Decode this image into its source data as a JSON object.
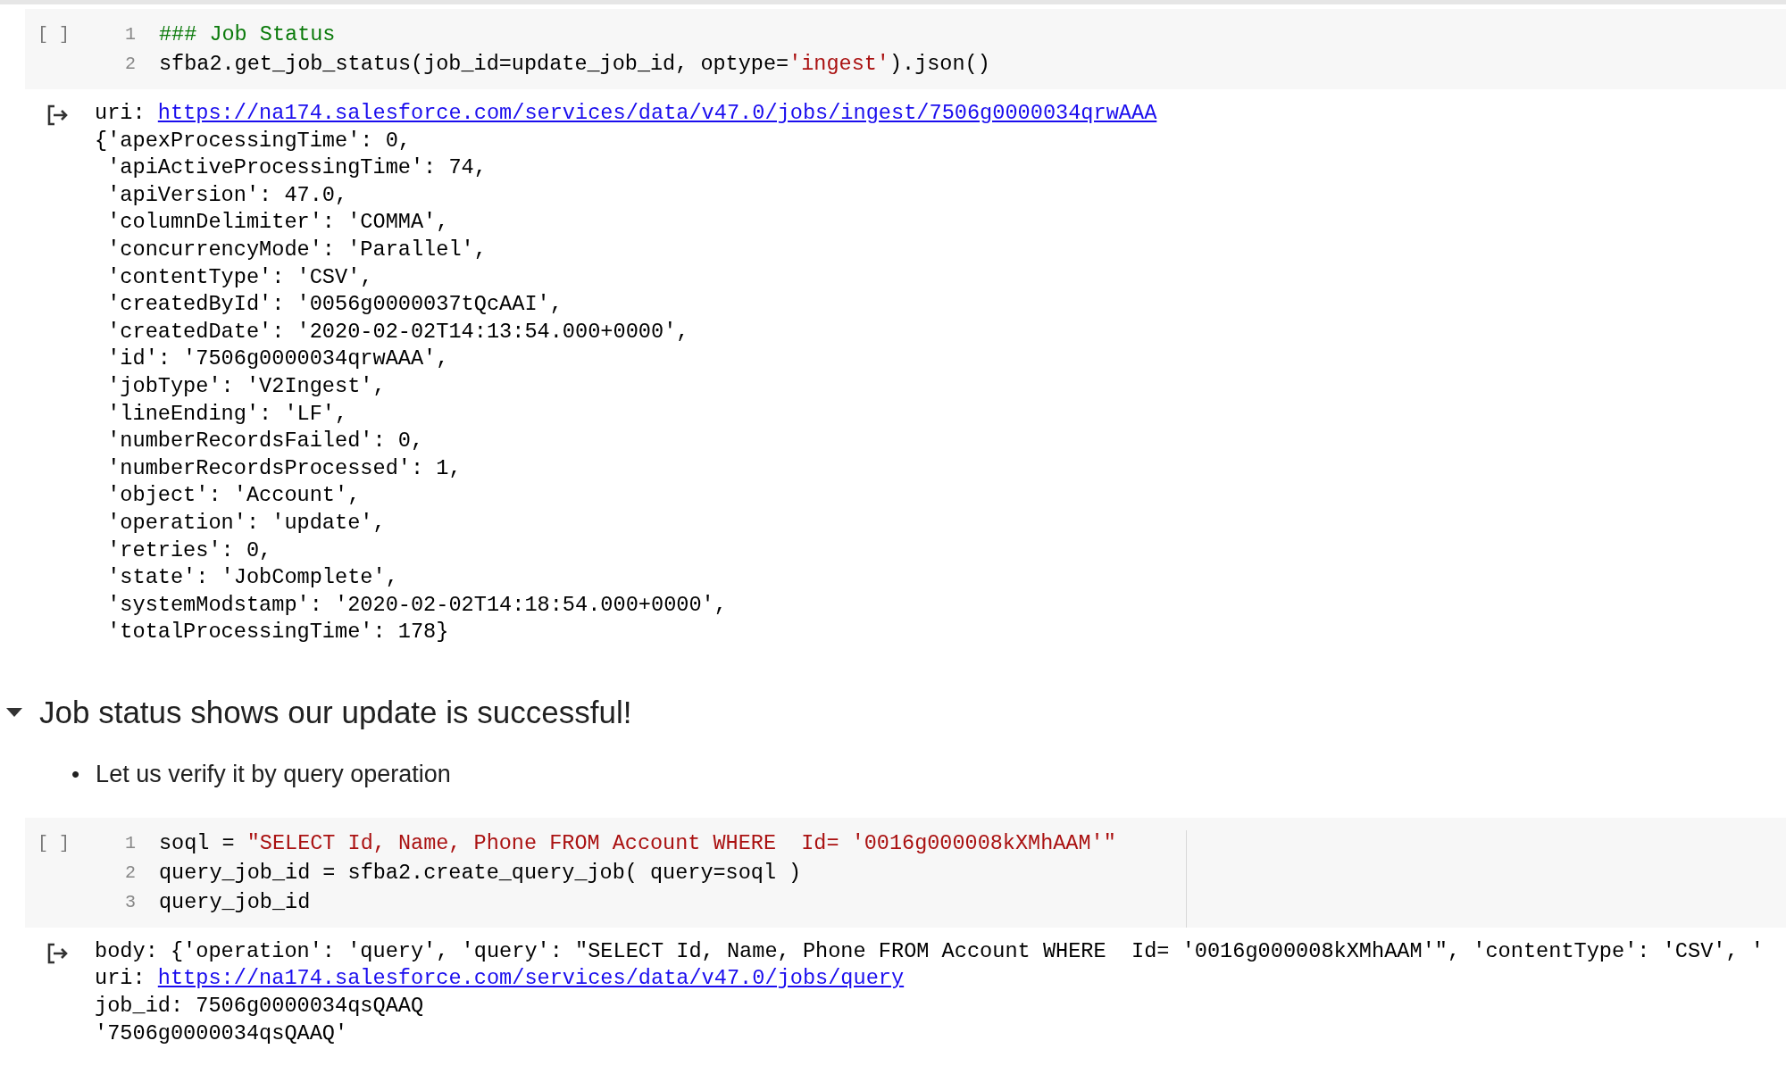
{
  "cells": [
    {
      "kind": "code",
      "bracket": "[ ]",
      "lines": [
        {
          "number": "1",
          "segments": [
            {
              "kind": "comment",
              "text": "### Job Status"
            }
          ]
        },
        {
          "number": "2",
          "segments": [
            {
              "kind": "plain",
              "text": "sfba2.get_job_status(job_id=update_job_id, optype="
            },
            {
              "kind": "string",
              "text": "'ingest'"
            },
            {
              "kind": "plain",
              "text": ").json()"
            }
          ]
        }
      ],
      "output": [
        [
          {
            "kind": "plain",
            "text": "uri: "
          },
          {
            "kind": "link",
            "text": "https://na174.salesforce.com/services/data/v47.0/jobs/ingest/7506g0000034qrwAAA"
          }
        ],
        [
          {
            "kind": "plain",
            "text": "{'apexProcessingTime': 0,"
          }
        ],
        [
          {
            "kind": "plain",
            "text": " 'apiActiveProcessingTime': 74,"
          }
        ],
        [
          {
            "kind": "plain",
            "text": " 'apiVersion': 47.0,"
          }
        ],
        [
          {
            "kind": "plain",
            "text": " 'columnDelimiter': 'COMMA',"
          }
        ],
        [
          {
            "kind": "plain",
            "text": " 'concurrencyMode': 'Parallel',"
          }
        ],
        [
          {
            "kind": "plain",
            "text": " 'contentType': 'CSV',"
          }
        ],
        [
          {
            "kind": "plain",
            "text": " 'createdById': '0056g0000037tQcAAI',"
          }
        ],
        [
          {
            "kind": "plain",
            "text": " 'createdDate': '2020-02-02T14:13:54.000+0000',"
          }
        ],
        [
          {
            "kind": "plain",
            "text": " 'id': '7506g0000034qrwAAA',"
          }
        ],
        [
          {
            "kind": "plain",
            "text": " 'jobType': 'V2Ingest',"
          }
        ],
        [
          {
            "kind": "plain",
            "text": " 'lineEnding': 'LF',"
          }
        ],
        [
          {
            "kind": "plain",
            "text": " 'numberRecordsFailed': 0,"
          }
        ],
        [
          {
            "kind": "plain",
            "text": " 'numberRecordsProcessed': 1,"
          }
        ],
        [
          {
            "kind": "plain",
            "text": " 'object': 'Account',"
          }
        ],
        [
          {
            "kind": "plain",
            "text": " 'operation': 'update',"
          }
        ],
        [
          {
            "kind": "plain",
            "text": " 'retries': 0,"
          }
        ],
        [
          {
            "kind": "plain",
            "text": " 'state': 'JobComplete',"
          }
        ],
        [
          {
            "kind": "plain",
            "text": " 'systemModstamp': '2020-02-02T14:18:54.000+0000',"
          }
        ],
        [
          {
            "kind": "plain",
            "text": " 'totalProcessingTime': 178}"
          }
        ]
      ]
    },
    {
      "kind": "markdown",
      "expanded": true,
      "heading": "Job status shows our update is successful!",
      "bullets": [
        {
          "marker": "•",
          "text": "Let us verify it by query operation"
        }
      ]
    },
    {
      "kind": "code",
      "bracket": "[ ]",
      "lines": [
        {
          "number": "1",
          "segments": [
            {
              "kind": "plain",
              "text": "soql = "
            },
            {
              "kind": "string",
              "text": "\"SELECT Id, Name, Phone FROM Account WHERE  Id= '0016g000008kXMhAAM'\""
            }
          ]
        },
        {
          "number": "2",
          "segments": [
            {
              "kind": "plain",
              "text": "query_job_id = sfba2.create_query_job( query=soql )"
            }
          ]
        },
        {
          "number": "3",
          "segments": [
            {
              "kind": "plain",
              "text": "query_job_id"
            }
          ]
        }
      ],
      "output": [
        [
          {
            "kind": "plain",
            "text": "body: {'operation': 'query', 'query': \"SELECT Id, Name, Phone FROM Account WHERE  Id= '0016g000008kXMhAAM'\", 'contentType': 'CSV', '"
          }
        ],
        [
          {
            "kind": "plain",
            "text": "uri: "
          },
          {
            "kind": "link",
            "text": "https://na174.salesforce.com/services/data/v47.0/jobs/query"
          }
        ],
        [
          {
            "kind": "plain",
            "text": "job_id: 7506g0000034qsQAAQ"
          }
        ],
        [
          {
            "kind": "plain",
            "text": "'7506g0000034qsQAAQ'"
          }
        ]
      ]
    }
  ]
}
